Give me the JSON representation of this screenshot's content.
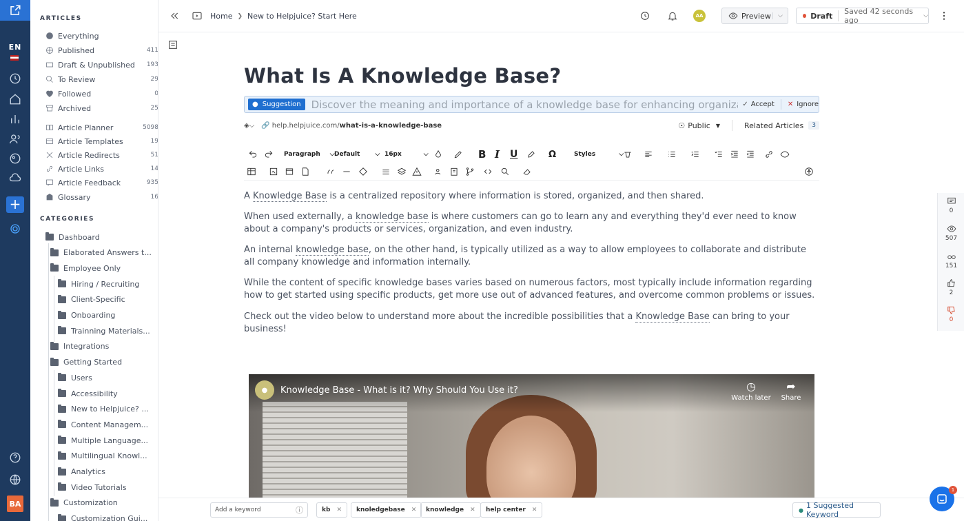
{
  "rail": {
    "language": "EN",
    "avatar": "BA"
  },
  "sidebar": {
    "articles_title": "ARTICLES",
    "articles": [
      {
        "label": "Everything",
        "count": "",
        "icon": "info-icon"
      },
      {
        "label": "Published",
        "count": "411",
        "icon": "globe-icon"
      },
      {
        "label": "Draft & Unpublished",
        "count": "193",
        "icon": "draft-icon"
      },
      {
        "label": "To Review",
        "count": "29",
        "icon": "search-icon"
      },
      {
        "label": "Followed",
        "count": "0",
        "icon": "heart-icon"
      },
      {
        "label": "Archived",
        "count": "25",
        "icon": "archive-icon"
      }
    ],
    "tools": [
      {
        "label": "Article Planner",
        "count": "5098",
        "icon": "book-icon"
      },
      {
        "label": "Article Templates",
        "count": "19",
        "icon": "template-icon"
      },
      {
        "label": "Article Redirects",
        "count": "51",
        "icon": "redirect-icon"
      },
      {
        "label": "Article Links",
        "count": "14",
        "icon": "link-icon"
      },
      {
        "label": "Article Feedback",
        "count": "935",
        "icon": "feedback-icon"
      },
      {
        "label": "Glossary",
        "count": "16",
        "icon": "glossary-icon"
      }
    ],
    "categories_title": "CATEGORIES",
    "categories": [
      {
        "label": "Dashboard",
        "level": 0
      },
      {
        "label": "Elaborated Answers t...",
        "level": 1
      },
      {
        "label": "Employee Only",
        "level": 1
      },
      {
        "label": "Hiring / Recruiting",
        "level": 2
      },
      {
        "label": "Client-Specific",
        "level": 2
      },
      {
        "label": "Onboarding",
        "level": 2
      },
      {
        "label": "Trainning Materials...",
        "level": 2
      },
      {
        "label": "Integrations",
        "level": 1
      },
      {
        "label": "Getting Started",
        "level": 1
      },
      {
        "label": "Users",
        "level": 2
      },
      {
        "label": "Accessibility",
        "level": 2
      },
      {
        "label": "New to Helpjuice? ...",
        "level": 2
      },
      {
        "label": "Content Managem...",
        "level": 2
      },
      {
        "label": "Multiple Language...",
        "level": 2
      },
      {
        "label": "Multilingual Knowl...",
        "level": 2
      },
      {
        "label": "Analytics",
        "level": 2
      },
      {
        "label": "Video Tutorials",
        "level": 2
      },
      {
        "label": "Customization",
        "level": 1
      },
      {
        "label": "Customization Gui...",
        "level": 2
      }
    ]
  },
  "topbar": {
    "breadcrumb_home": "Home",
    "breadcrumb_current": "New to Helpjuice? Start Here",
    "user_initials": "AA",
    "preview_label": "Preview",
    "draft_label": "Draft",
    "saved_text": "Saved 42 seconds ago"
  },
  "editor": {
    "title": "What Is A Knowledge Base?",
    "suggestion_tag": "Suggestion",
    "suggestion_text": "Discover the meaning and importance of a knowledge base for enhancing organizational efficiency.",
    "accept_label": "Accept",
    "ignore_label": "Ignore",
    "url_prefix": "help.helpjuice.com/",
    "url_slug": "what-is-a-knowledge-base",
    "visibility": "Public",
    "related_label": "Related Articles",
    "related_count": "3",
    "toolbar": {
      "paragraph": "Paragraph",
      "font": "Default",
      "size": "16px",
      "styles": "Styles"
    },
    "paragraphs": [
      {
        "a": "A ",
        "u": "Knowledge Base",
        "b": " is a centralized repository where information is stored, organized, and then shared."
      },
      {
        "a": "When used externally, a ",
        "u": "knowledge base",
        "b": " is where customers can go to learn any and everything they'd ever need to know about a company's products or services, organization, and even industry."
      },
      {
        "a": "An internal ",
        "u": "knowledge base",
        "b": ", on the other hand, is typically utilized as a way to allow employees to collaborate and distribute all company knowledge and information internally."
      },
      {
        "a": "While the content of specific knowledge bases varies based on numerous factors, most typically include information regarding how to get started using specific products, get more use out of advanced features, and overcome common problems or issues.",
        "u": "",
        "b": ""
      },
      {
        "a": "Check out the video below to understand more about the incredible possibilities that a ",
        "u": "Knowledge Base",
        "b": " can bring to your business!"
      }
    ],
    "video": {
      "title": "Knowledge Base - What is it? Why Should You Use it?",
      "watch_later": "Watch later",
      "share": "Share"
    }
  },
  "stats": [
    {
      "icon": "comment-icon",
      "value": "0"
    },
    {
      "icon": "eye-icon",
      "value": "507"
    },
    {
      "icon": "glasses-icon",
      "value": "151"
    },
    {
      "icon": "thumbs-up-icon",
      "value": "2"
    },
    {
      "icon": "thumbs-down-icon",
      "value": "0"
    }
  ],
  "bottom": {
    "keyword_placeholder": "Add a keyword",
    "keywords": [
      "kb",
      "knoledgebase",
      "knowledge",
      "help center"
    ],
    "suggested": "1 Suggested Keyword"
  },
  "chat_badge": "1",
  "colors": {
    "rail": "#1e3a5f",
    "accent": "#2a72d4",
    "draft_dot": "#e0533a",
    "thumbs_down": "#d64a2e"
  }
}
